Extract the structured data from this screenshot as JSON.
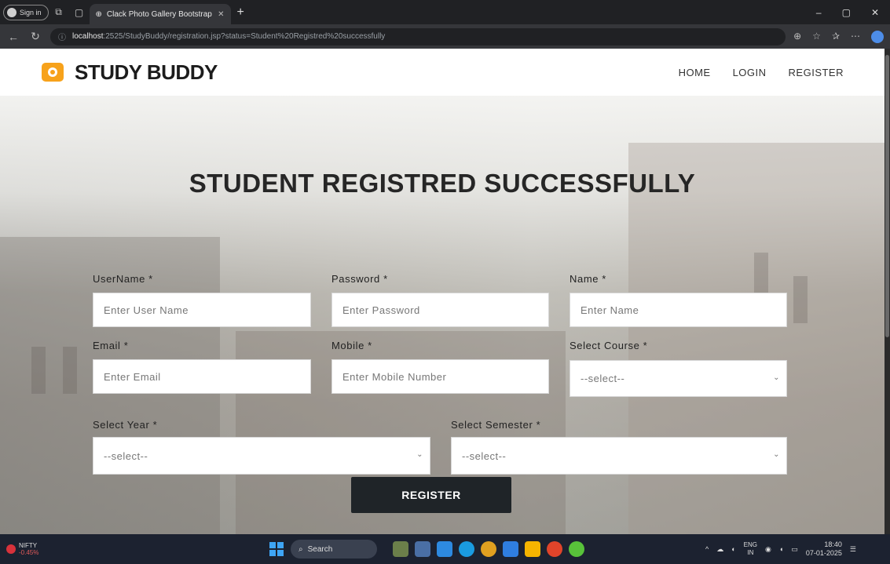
{
  "browser": {
    "signin_label": "Sign in",
    "tab_title": "Clack Photo Gallery Bootstrap Re",
    "url_host": "localhost",
    "url_path": ":2525/StudyBuddy/registration.jsp?status=Student%20Registred%20successfully"
  },
  "navbar": {
    "brand": "STUDY BUDDY",
    "links": [
      "HOME",
      "LOGIN",
      "REGISTER"
    ]
  },
  "page": {
    "headline": "STUDENT REGISTRED SUCCESSFULLY",
    "fields": {
      "username": {
        "label": "UserName *",
        "placeholder": "Enter User Name"
      },
      "password": {
        "label": "Password *",
        "placeholder": "Enter Password"
      },
      "name": {
        "label": "Name *",
        "placeholder": "Enter Name"
      },
      "email": {
        "label": "Email *",
        "placeholder": "Enter Email"
      },
      "mobile": {
        "label": "Mobile *",
        "placeholder": "Enter Mobile Number"
      },
      "course": {
        "label": "Select Course *",
        "value": "--select--"
      },
      "year": {
        "label": "Select Year *",
        "value": "--select--"
      },
      "semester": {
        "label": "Select Semester *",
        "value": "--select--"
      }
    },
    "submit_label": "REGISTER"
  },
  "taskbar": {
    "ticker_name": "NIFTY",
    "ticker_change": "-0.45%",
    "search_label": "Search",
    "lang_top": "ENG",
    "lang_bottom": "IN",
    "time": "18:40",
    "date": "07-01-2025"
  }
}
